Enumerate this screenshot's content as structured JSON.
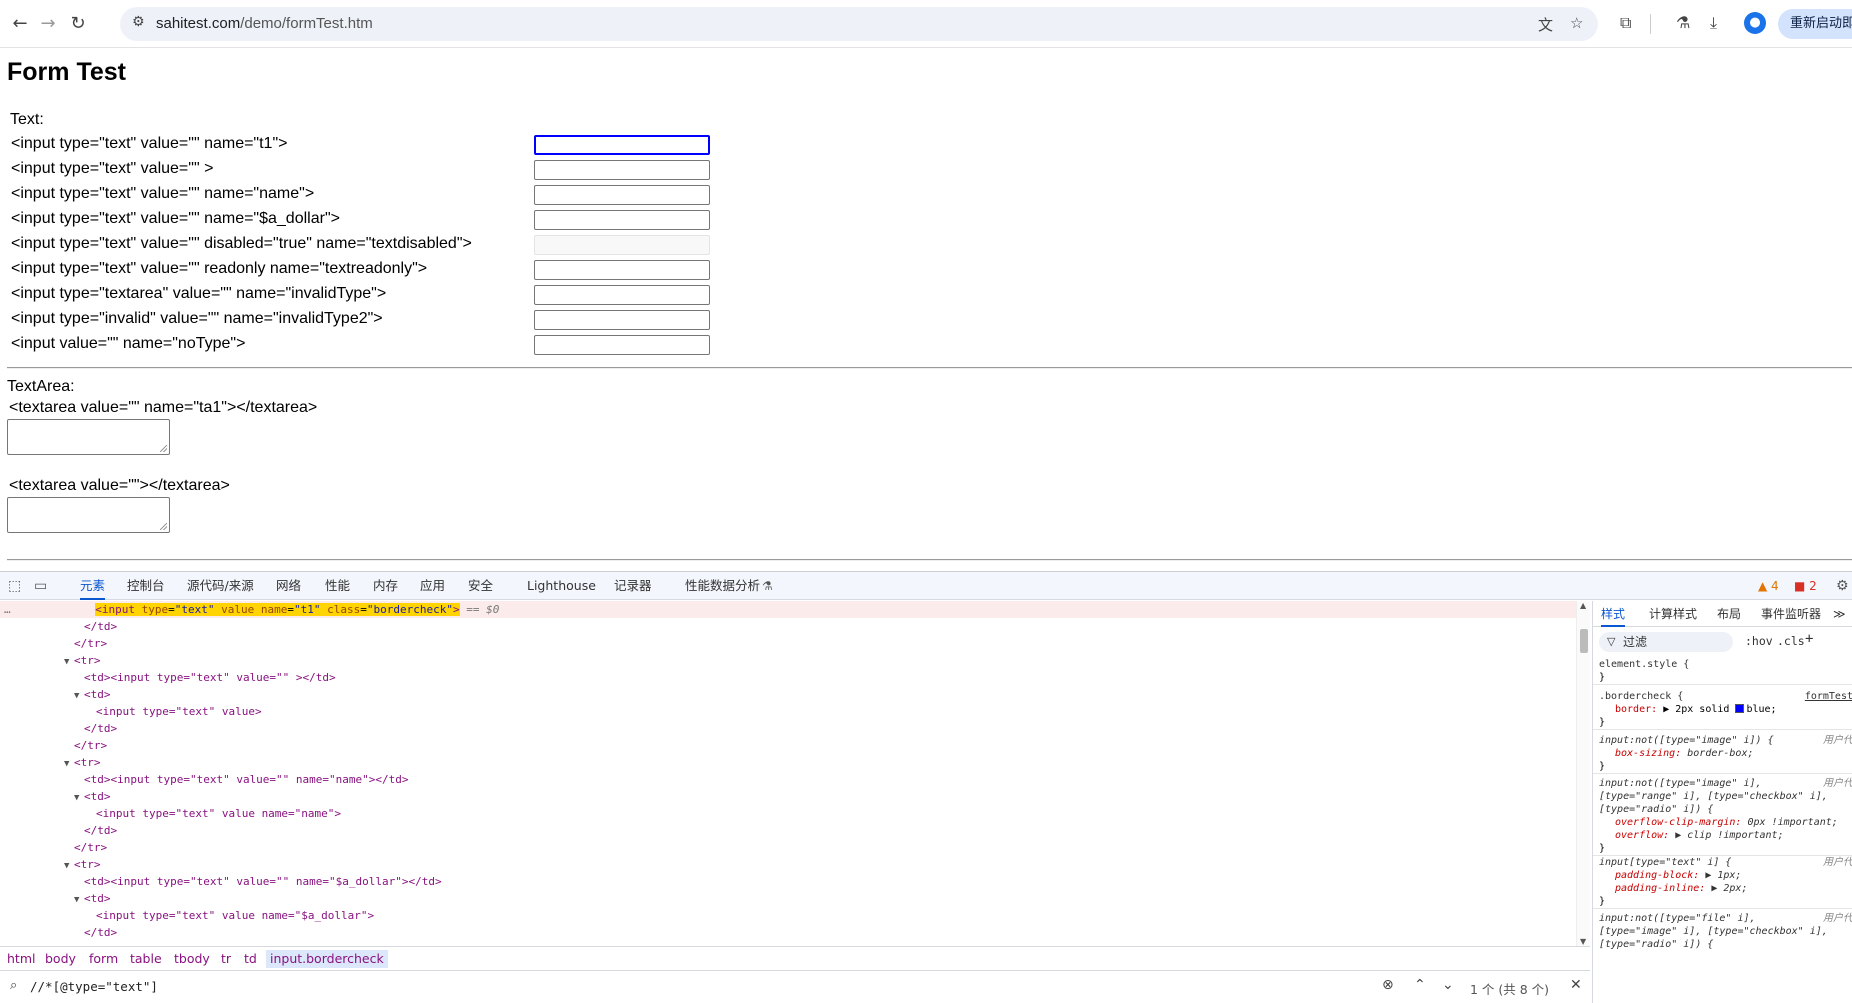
{
  "browser": {
    "url_host": "sahitest.com",
    "url_path": "/demo/formTest.htm",
    "restart_label": "重新启动即可"
  },
  "page": {
    "title": "Form Test",
    "text_section_label": "Text:",
    "text_rows": [
      "<input type=\"text\" value=\"\" name=\"t1\">",
      "<input type=\"text\" value=\"\" >",
      "<input type=\"text\" value=\"\" name=\"name\">",
      "<input type=\"text\" value=\"\" name=\"$a_dollar\">",
      "<input type=\"text\" value=\"\" disabled=\"true\" name=\"textdisabled\">",
      "<input type=\"text\" value=\"\" readonly name=\"textreadonly\">",
      "<input type=\"textarea\" value=\"\" name=\"invalidType\">",
      "<input type=\"invalid\" value=\"\" name=\"invalidType2\">",
      "<input value=\"\" name=\"noType\">"
    ],
    "textarea_section_label": "TextArea:",
    "textarea_rows": [
      "<textarea value=\"\" name=\"ta1\"></textarea>",
      "<textarea value=\"\"></textarea>"
    ]
  },
  "devtools": {
    "tabs": [
      "元素",
      "控制台",
      "源代码/来源",
      "网络",
      "性能",
      "内存",
      "应用",
      "安全",
      "Lighthouse",
      "记录器",
      "性能数据分析"
    ],
    "warnings": "4",
    "errors": "2",
    "selected_node": {
      "tag_open": "<input",
      "a1": "type",
      "v1": "\"text\"",
      "a2": "value",
      "a3": "name",
      "v3": "\"t1\"",
      "a4": "class",
      "v4": "\"bordercheck\"",
      "close": ">",
      "marker": "== $0"
    },
    "dom_lines": [
      "</td>",
      "</tr>",
      "<tr>",
      "<td><input type=\"text\" value=\"\" ></td>",
      "<td>",
      "<input type=\"text\" value>",
      "</td>",
      "</tr>",
      "<tr>",
      "<td><input type=\"text\" value=\"\" name=\"name\"></td>",
      "<td>",
      "<input type=\"text\" value name=\"name\">",
      "</td>",
      "</tr>",
      "<tr>",
      "<td><input type=\"text\" value=\"\" name=\"$a_dollar\"></td>",
      "<td>",
      "<input type=\"text\" value name=\"$a_dollar\">",
      "</td>"
    ],
    "breadcrumbs": [
      "html",
      "body",
      "form",
      "table",
      "tbody",
      "tr",
      "td",
      "input.bordercheck"
    ],
    "search_query": "//*[@type=\"text\"]",
    "search_count": "1 个 (共 8 个)",
    "styles_tabs": [
      "样式",
      "计算样式",
      "布局",
      "事件监听器"
    ],
    "filter_placeholder": "过滤",
    "hov": ":hov",
    "cls": ".cls",
    "rules": {
      "element_style": "element.style {",
      "close": "}",
      "bordercheck_sel": ".bordercheck {",
      "bordercheck_src": "formTest",
      "border_prop": "border:",
      "border_val": "▶ 2px solid",
      "border_color": "blue;",
      "r3_sel": "input:not([type=\"image\" i]) {",
      "ua_src": "用户代",
      "r3_prop": "box-sizing:",
      "r3_val": "border-box;",
      "r4_sel1": "input:not([type=\"image\" i],",
      "r4_sel2": "[type=\"range\" i], [type=\"checkbox\" i],",
      "r4_sel3": "[type=\"radio\" i]) {",
      "r4_p1": "overflow-clip-margin:",
      "r4_v1": "0px !important;",
      "r4_p2": "overflow:",
      "r4_v2": "▶ clip !important;",
      "r5_sel": "input[type=\"text\" i] {",
      "r5_p1": "padding-block:",
      "r5_v1": "▶ 1px;",
      "r5_p2": "padding-inline:",
      "r5_v2": "▶ 2px;",
      "r6_sel1": "input:not([type=\"file\" i],",
      "r6_sel2": "[type=\"image\" i], [type=\"checkbox\" i],",
      "r6_sel3": "[type=\"radio\" i]) {"
    }
  }
}
